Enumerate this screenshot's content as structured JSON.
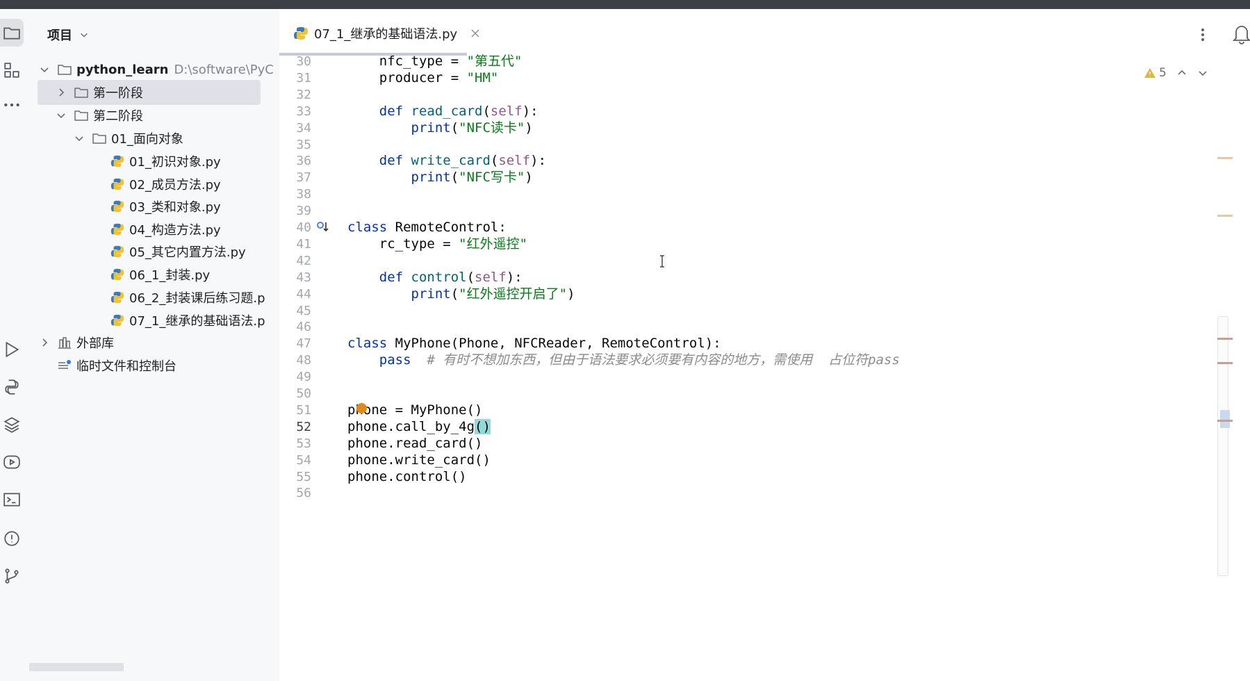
{
  "project_panel": {
    "title": "项目",
    "tree": [
      {
        "label": "python_learn",
        "hint": "D:\\software\\PyC",
        "type": "folder",
        "expanded": true
      },
      {
        "label": "第一阶段",
        "type": "folder",
        "expanded": false,
        "selected": true
      },
      {
        "label": "第二阶段",
        "type": "folder",
        "expanded": true
      },
      {
        "label": "01_面向对象",
        "type": "folder",
        "expanded": true
      },
      {
        "label": "01_初识对象.py",
        "type": "python-file"
      },
      {
        "label": "02_成员方法.py",
        "type": "python-file"
      },
      {
        "label": "03_类和对象.py",
        "type": "python-file"
      },
      {
        "label": "04_构造方法.py",
        "type": "python-file"
      },
      {
        "label": "05_其它内置方法.py",
        "type": "python-file"
      },
      {
        "label": "06_1_封装.py",
        "type": "python-file"
      },
      {
        "label": "06_2_封装课后练习题.p",
        "type": "python-file"
      },
      {
        "label": "07_1_继承的基础语法.p",
        "type": "python-file"
      },
      {
        "label": "外部库",
        "type": "library",
        "expanded": false
      },
      {
        "label": "临时文件和控制台",
        "type": "scratches"
      }
    ]
  },
  "editor": {
    "tab_label": "07_1_继承的基础语法.py",
    "warnings_count": "5",
    "current_line": "52",
    "lines": [
      {
        "n": "30",
        "tokens": [
          [
            "",
            "    nfc_type = "
          ],
          [
            "str",
            "\"第五代\""
          ]
        ]
      },
      {
        "n": "31",
        "tokens": [
          [
            "",
            "    producer = "
          ],
          [
            "str",
            "\"HM\""
          ]
        ]
      },
      {
        "n": "32",
        "tokens": []
      },
      {
        "n": "33",
        "tokens": [
          [
            "kw",
            "    def "
          ],
          [
            "fn",
            "read_card"
          ],
          [
            "",
            "("
          ],
          [
            "self",
            "self"
          ],
          [
            "",
            "):"
          ]
        ]
      },
      {
        "n": "34",
        "tokens": [
          [
            "",
            "        "
          ],
          [
            "kw",
            "print"
          ],
          [
            "",
            "("
          ],
          [
            "str",
            "\"NFC读卡\""
          ],
          [
            "",
            ")"
          ]
        ]
      },
      {
        "n": "35",
        "tokens": []
      },
      {
        "n": "36",
        "tokens": [
          [
            "kw",
            "    def "
          ],
          [
            "fn",
            "write_card"
          ],
          [
            "",
            "("
          ],
          [
            "self",
            "self"
          ],
          [
            "",
            "):"
          ]
        ]
      },
      {
        "n": "37",
        "tokens": [
          [
            "",
            "        "
          ],
          [
            "kw",
            "print"
          ],
          [
            "",
            "("
          ],
          [
            "str",
            "\"NFC写卡\""
          ],
          [
            "",
            ")"
          ]
        ]
      },
      {
        "n": "38",
        "tokens": []
      },
      {
        "n": "39",
        "tokens": []
      },
      {
        "n": "40",
        "tokens": [
          [
            "kw",
            "class "
          ],
          [
            "",
            "RemoteControl:"
          ]
        ]
      },
      {
        "n": "41",
        "tokens": [
          [
            "",
            "    rc_type = "
          ],
          [
            "str",
            "\"红外遥控\""
          ]
        ]
      },
      {
        "n": "42",
        "tokens": []
      },
      {
        "n": "43",
        "tokens": [
          [
            "kw",
            "    def "
          ],
          [
            "fn",
            "control"
          ],
          [
            "",
            "("
          ],
          [
            "self",
            "self"
          ],
          [
            "",
            "):"
          ]
        ]
      },
      {
        "n": "44",
        "tokens": [
          [
            "",
            "        "
          ],
          [
            "kw",
            "print"
          ],
          [
            "",
            "("
          ],
          [
            "str",
            "\"红外遥控开启了\""
          ],
          [
            "",
            ")"
          ]
        ]
      },
      {
        "n": "45",
        "tokens": []
      },
      {
        "n": "46",
        "tokens": []
      },
      {
        "n": "47",
        "tokens": [
          [
            "kw",
            "class "
          ],
          [
            "",
            "MyPhone(Phone, NFCReader, RemoteControl):"
          ]
        ]
      },
      {
        "n": "48",
        "tokens": [
          [
            "kw",
            "    pass"
          ],
          [
            "",
            "  "
          ],
          [
            "cm",
            "# 有时不想加东西，但由于语法要求必须要有内容的地方，需使用  占位符pass"
          ]
        ]
      },
      {
        "n": "49",
        "tokens": []
      },
      {
        "n": "50",
        "tokens": []
      },
      {
        "n": "51",
        "tokens": [
          [
            "",
            "phone = MyPhone()"
          ]
        ]
      },
      {
        "n": "52",
        "tokens": [
          [
            "",
            "phone.call_by_4g"
          ],
          [
            "match",
            "()"
          ]
        ]
      },
      {
        "n": "53",
        "tokens": [
          [
            "",
            "phone.read_card()"
          ]
        ]
      },
      {
        "n": "54",
        "tokens": [
          [
            "",
            "phone.write_card()"
          ]
        ]
      },
      {
        "n": "55",
        "tokens": [
          [
            "",
            "phone.control()"
          ]
        ]
      },
      {
        "n": "56",
        "tokens": []
      }
    ]
  },
  "icons": {
    "toolstrip": [
      "folder-icon",
      "structure-icon",
      "more-tools-icon",
      "run-icon",
      "python-console-icon",
      "layers-icon",
      "services-icon",
      "terminal-icon",
      "problems-icon",
      "git-icon"
    ]
  },
  "colors": {
    "keyword": "#0033b3",
    "string": "#067d17",
    "function": "#00627a",
    "self": "#94558d",
    "comment": "#8c8c8c",
    "bracket_match": "#93d9d9",
    "selection": "#dfe1e6"
  }
}
